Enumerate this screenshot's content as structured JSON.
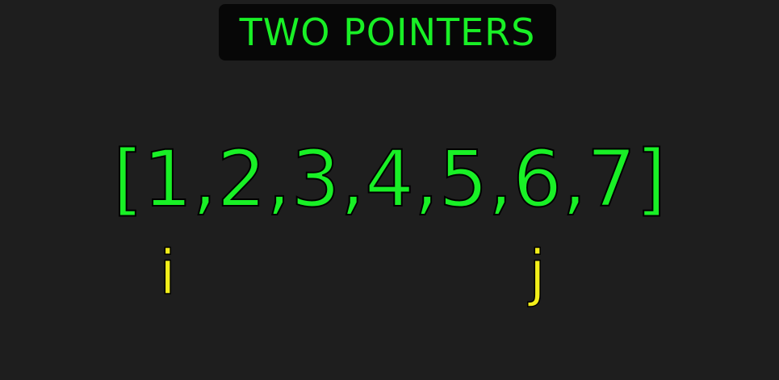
{
  "title": "TWO POINTERS",
  "array": {
    "open_bracket": "[",
    "close_bracket": "]",
    "separator": ", ",
    "values": [
      "1",
      "2",
      "3",
      "4",
      "5",
      "6",
      "7"
    ]
  },
  "pointers": {
    "left": {
      "label": "i",
      "index": 0
    },
    "right": {
      "label": "j",
      "index": 5
    }
  },
  "colors": {
    "background": "#1e1e1e",
    "title_box": "#070707",
    "array_text": "#19f026",
    "pointer_text": "#f2ee1a"
  }
}
